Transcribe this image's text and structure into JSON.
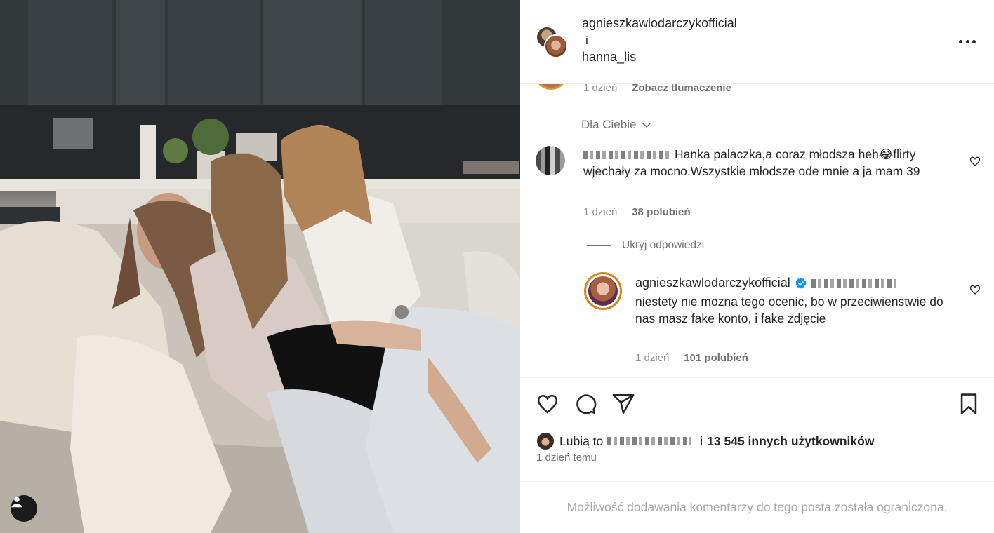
{
  "post": {
    "photo_alt": "",
    "icons": {
      "user_tag": "user-tag-icon",
      "more": "more-options-icon",
      "like": "heart-icon",
      "comment": "comment-icon",
      "share": "paper-plane-icon",
      "save": "bookmark-icon",
      "verified": "verified-badge-icon",
      "filter_chevron": "chevron-down-icon"
    },
    "colors": {
      "accent_verified": "#0095f6",
      "muted_text": "#737373",
      "story_ring": "#d4861c"
    }
  },
  "header": {
    "user1": "agnieszkawlodarczykofficial",
    "conjunction": "i",
    "user2": "hanna_lis"
  },
  "partial_comment": {
    "time": "1 dzień",
    "translate": "Zobacz tłumaczenie"
  },
  "filter": {
    "label": "Dla Ciebie"
  },
  "comment1": {
    "username_hidden": "",
    "text": "Hanka palaczka,a coraz młodsza heh😂flirty wjechały za mocno.Wszystkie młodsze ode mnie a ja mam 39",
    "time": "1 dzień",
    "likes": "38 polubień"
  },
  "replies_toggle": {
    "label": "Ukryj odpowiedzi"
  },
  "reply1": {
    "username": "agnieszkawlodarczykofficial",
    "text": "niestety nie mozna tego ocenic, bo w przeciwienstwie do nas masz fake konto, i fake zdjęcie",
    "time": "1 dzień",
    "likes": "101 polubień"
  },
  "likes": {
    "prefix": "Lubią to",
    "connector": "i",
    "count_text": "13 545 innych użytkowników"
  },
  "posted": {
    "time_ago": "1 dzień temu"
  },
  "comments_disabled": {
    "message": "Możliwość dodawania komentarzy do tego posta została ograniczona."
  }
}
